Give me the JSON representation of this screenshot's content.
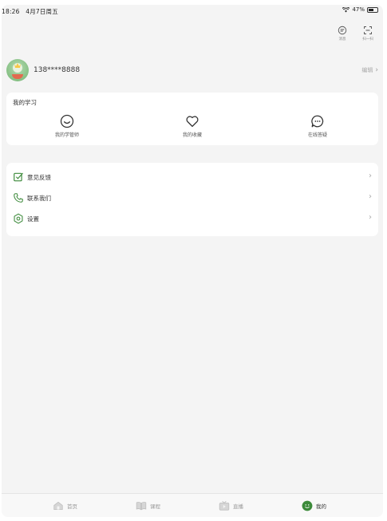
{
  "status": {
    "time": "18:26",
    "date": "4月7日周五",
    "battery": "47%"
  },
  "top_actions": [
    {
      "label": "消息",
      "icon": "message-icon"
    },
    {
      "label": "扫一扫",
      "icon": "scan-icon"
    }
  ],
  "profile": {
    "phone": "138****8888",
    "edit_label": "编辑"
  },
  "study": {
    "title": "我的学习",
    "items": [
      {
        "label": "我的学管师",
        "icon": "smile-icon"
      },
      {
        "label": "我的收藏",
        "icon": "heart-icon"
      },
      {
        "label": "在线答疑",
        "icon": "chat-bubble-icon"
      }
    ]
  },
  "menu": [
    {
      "label": "意见反馈",
      "icon": "feedback-icon"
    },
    {
      "label": "联系我们",
      "icon": "phone-icon"
    },
    {
      "label": "设置",
      "icon": "settings-icon"
    }
  ],
  "tabs": [
    {
      "label": "首页",
      "icon": "home-icon",
      "active": false
    },
    {
      "label": "课程",
      "icon": "book-icon",
      "active": false
    },
    {
      "label": "直播",
      "icon": "live-icon",
      "active": false
    },
    {
      "label": "我的",
      "icon": "profile-icon",
      "active": true
    }
  ],
  "colors": {
    "accent": "#3c8a3a",
    "background": "#f4f4f4",
    "card": "#ffffff"
  }
}
